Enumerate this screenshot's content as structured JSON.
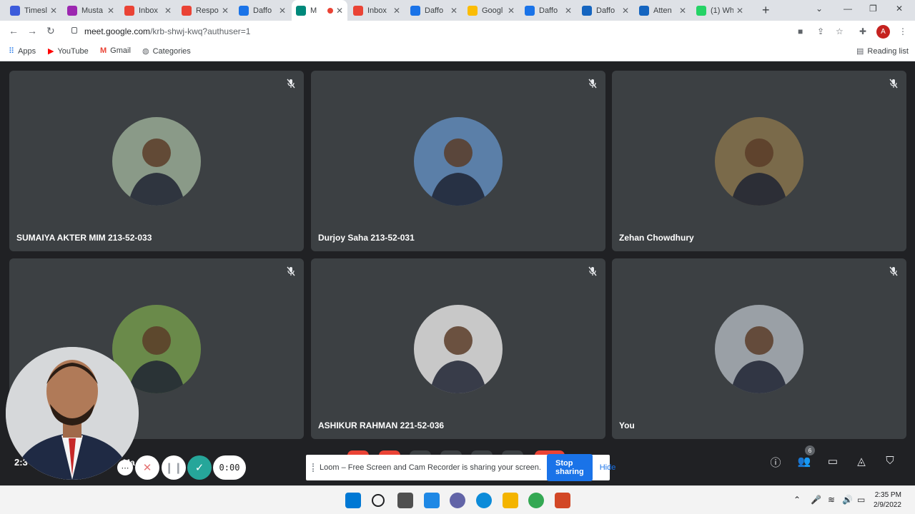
{
  "browser": {
    "tabs": [
      {
        "label": "Timesl",
        "color": "#3b5bdb"
      },
      {
        "label": "Musta",
        "color": "#9c27b0"
      },
      {
        "label": "Inbox",
        "color": "#ea4335"
      },
      {
        "label": "Respo",
        "color": "#ea4335"
      },
      {
        "label": "Daffo",
        "color": "#1a73e8"
      },
      {
        "label": "M",
        "color": "#00897b"
      },
      {
        "label": "Inbox",
        "color": "#ea4335"
      },
      {
        "label": "Daffo",
        "color": "#1a73e8"
      },
      {
        "label": "Googl",
        "color": "#fbbc04"
      },
      {
        "label": "Daffo",
        "color": "#1a73e8"
      },
      {
        "label": "Daffo",
        "color": "#1565c0"
      },
      {
        "label": "Atten",
        "color": "#1565c0"
      },
      {
        "label": "(1) Wh",
        "color": "#25d366"
      }
    ],
    "url_host": "meet.google.com",
    "url_path": "/krb-shwj-kwq?authuser=1",
    "profile_initial": "A",
    "bookmarks": [
      "Apps",
      "YouTube",
      "Gmail",
      "Categories"
    ],
    "reading_list": "Reading list"
  },
  "meet": {
    "participants": [
      {
        "name": "SUMAIYA AKTER MIM 213-52-033",
        "avatar": "#8a9a88"
      },
      {
        "name": "Durjoy Saha 213-52-031",
        "avatar": "#5b7fa8"
      },
      {
        "name": "Zehan Chowdhury",
        "avatar": "#7a6a4a"
      },
      {
        "name": "",
        "avatar": "#6a8a4a"
      },
      {
        "name": "ASHIKUR RAHMAN 221-52-036",
        "avatar": "#c8c8c8"
      },
      {
        "name": "You",
        "avatar": "#9aa0a6"
      }
    ],
    "clock": "2:3",
    "partial_name": "Ma",
    "people_count": "6"
  },
  "loom": {
    "timer": "0:00",
    "message": "Loom – Free Screen and Cam Recorder is sharing your screen.",
    "stop_label": "Stop sharing",
    "hide_label": "Hide"
  },
  "taskbar": {
    "time": "2:35 PM",
    "date": "2/9/2022"
  }
}
